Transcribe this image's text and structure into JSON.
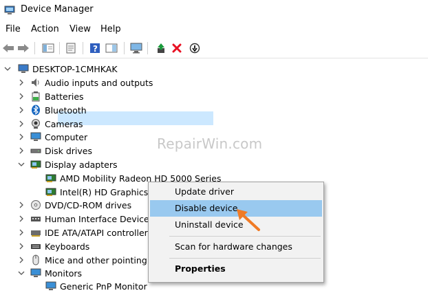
{
  "window": {
    "title": "Device Manager"
  },
  "menu": [
    "File",
    "Action",
    "View",
    "Help"
  ],
  "tree": {
    "root": "DESKTOP-1CMHKAK",
    "categories": [
      "Audio inputs and outputs",
      "Batteries",
      "Bluetooth",
      "Cameras",
      "Computer",
      "Disk drives",
      "Display adapters",
      "DVD/CD-ROM drives",
      "Human Interface Devices",
      "IDE ATA/ATAPI controllers",
      "Keyboards",
      "Mice and other pointing d",
      "Monitors"
    ],
    "display_children": [
      "AMD Mobility Radeon HD 5000 Series",
      "Intel(R) HD Graphics"
    ],
    "monitor_children": [
      "Generic PnP Monitor"
    ]
  },
  "context_menu": {
    "items": [
      "Update driver",
      "Disable device",
      "Uninstall device",
      "Scan for hardware changes",
      "Properties"
    ],
    "highlighted": "Disable device"
  },
  "watermark": "RepairWin.com",
  "colors": {
    "selection": "#cce8ff",
    "menu_highlight": "#99c9ef",
    "arrow": "#f07b26",
    "remove_x": "#e81123"
  }
}
